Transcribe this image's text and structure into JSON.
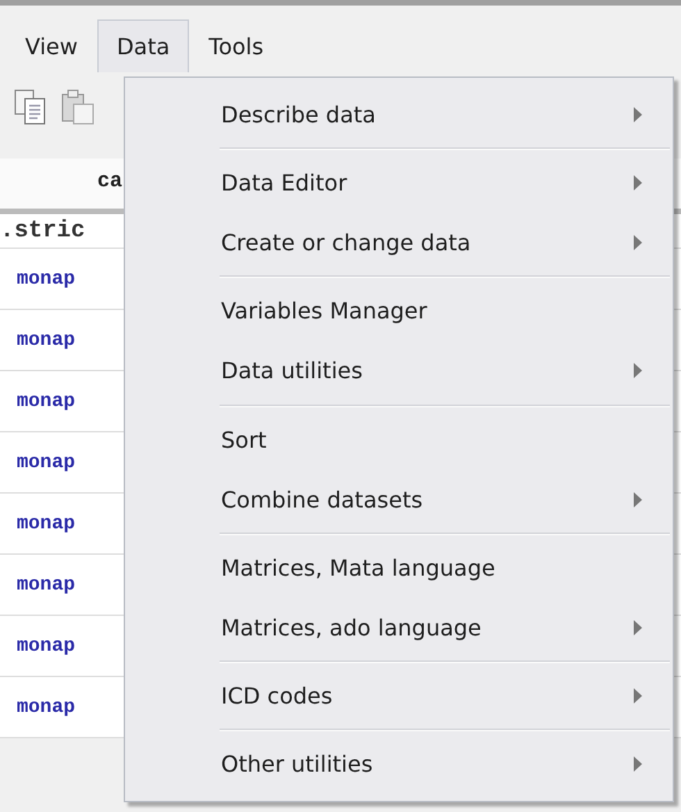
{
  "menubar": [
    {
      "label": "View",
      "selected": false
    },
    {
      "label": "Data",
      "selected": true
    },
    {
      "label": "Tools",
      "selected": false
    }
  ],
  "table": {
    "columns": [
      "ca"
    ],
    "rows": [
      ".stric",
      "monap",
      "monap",
      "monap",
      "monap",
      "monap",
      "monap",
      "monap",
      "monap"
    ]
  },
  "menu": {
    "groups": [
      [
        {
          "label": "Describe data",
          "submenu": true
        }
      ],
      [
        {
          "label": "Data Editor",
          "submenu": true
        },
        {
          "label": "Create or change data",
          "submenu": true
        }
      ],
      [
        {
          "label": "Variables Manager",
          "submenu": false
        },
        {
          "label": "Data utilities",
          "submenu": true
        }
      ],
      [
        {
          "label": "Sort",
          "submenu": false
        },
        {
          "label": "Combine datasets",
          "submenu": true
        }
      ],
      [
        {
          "label": "Matrices, Mata language",
          "submenu": false
        },
        {
          "label": "Matrices, ado language",
          "submenu": true
        }
      ],
      [
        {
          "label": "ICD codes",
          "submenu": true
        }
      ],
      [
        {
          "label": "Other utilities",
          "submenu": true
        }
      ]
    ]
  }
}
